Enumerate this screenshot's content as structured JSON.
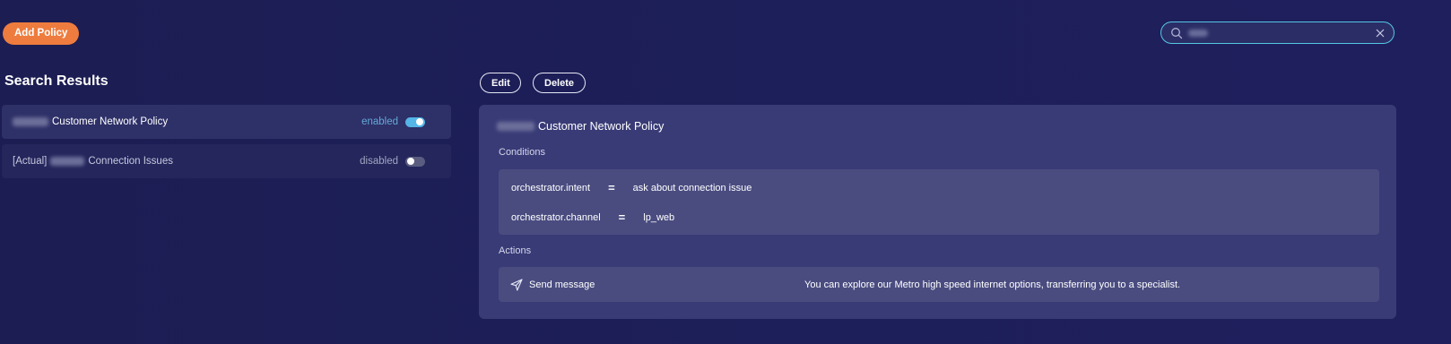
{
  "toolbar": {
    "add_policy_label": "Add Policy"
  },
  "search": {
    "placeholder": "",
    "value_blurred": true
  },
  "results": {
    "title": "Search Results",
    "items": [
      {
        "prefix": "",
        "name": "Customer Network Policy",
        "status": "enabled",
        "toggle_on": true
      },
      {
        "prefix": "[Actual]",
        "name": "Connection Issues",
        "status": "disabled",
        "toggle_on": false
      }
    ]
  },
  "detail": {
    "edit_label": "Edit",
    "delete_label": "Delete",
    "policy_name": "Customer Network Policy",
    "conditions_label": "Conditions",
    "conditions": [
      {
        "key": "orchestrator.intent",
        "operator": "=",
        "value": "ask about connection issue"
      },
      {
        "key": "orchestrator.channel",
        "operator": "=",
        "value": "lp_web"
      }
    ],
    "actions_label": "Actions",
    "actions": [
      {
        "type": "Send message",
        "message": "You can explore our Metro high speed internet options, transferring you to a specialist."
      }
    ]
  },
  "colors": {
    "background": "#1c1d52",
    "accent_orange": "#ee7c3e",
    "accent_cyan": "#55c7e6",
    "panel": "#393b77",
    "inner_box": "#4a4c80"
  },
  "icons": {
    "search": "search-icon",
    "clear": "close-icon",
    "send": "send-icon"
  }
}
